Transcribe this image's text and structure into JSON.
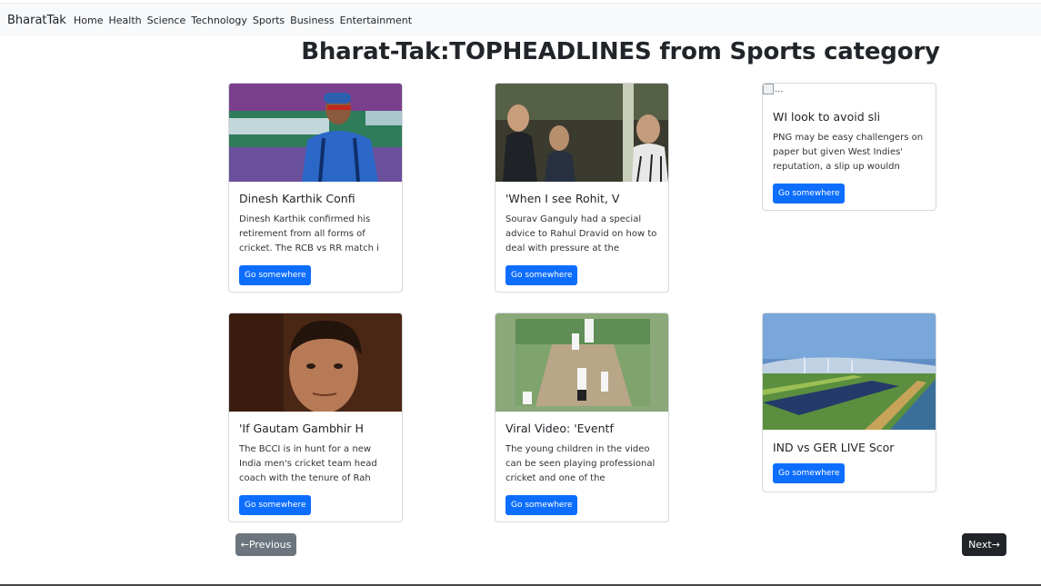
{
  "navbar": {
    "brand": "BharatTak",
    "links": [
      "Home",
      "Health",
      "Science",
      "Technology",
      "Sports",
      "Business",
      "Entertainment"
    ]
  },
  "heading": "Bharat-Tak:TOPHEADLINES from Sports category",
  "cards": [
    {
      "title": "Dinesh Karthik Confi",
      "description": "Dinesh Karthik confirmed his retirement from all forms of cricket. The RCB vs RR match i",
      "button": "Go somewhere",
      "image": "cricketer-photo"
    },
    {
      "title": "'When I see Rohit, V",
      "description": "Sourav Ganguly had a special advice to Rahul Dravid on how to deal with pressure at the",
      "button": "Go somewhere",
      "image": "spectators-photo"
    },
    {
      "title": "WI look to avoid sli",
      "description": "PNG may be easy challengers on paper but given West Indies' reputation, a slip up wouldn",
      "button": "Go somewhere",
      "image_alt": "..."
    },
    {
      "title": "'If Gautam Gambhir H",
      "description": "The BCCI is in hunt for a new India men's cricket team head coach with the tenure of Rah",
      "button": "Go somewhere",
      "image": "portrait-photo"
    },
    {
      "title": "Viral Video: 'Eventf",
      "description": "The young children in the video can be seen playing professional cricket and one of the",
      "button": "Go somewhere",
      "image": "cricket-pitch-photo"
    },
    {
      "title": "IND vs GER LIVE Scor",
      "description": "",
      "button": "Go somewhere",
      "image": "landscape-photo"
    }
  ],
  "pagination": {
    "previous": "←Previous",
    "next": "Next→"
  },
  "colors": {
    "primary_button": "#0d6efd",
    "previous_button": "#6c757d",
    "next_button": "#212529",
    "navbar_bg": "#f8f9fa"
  }
}
